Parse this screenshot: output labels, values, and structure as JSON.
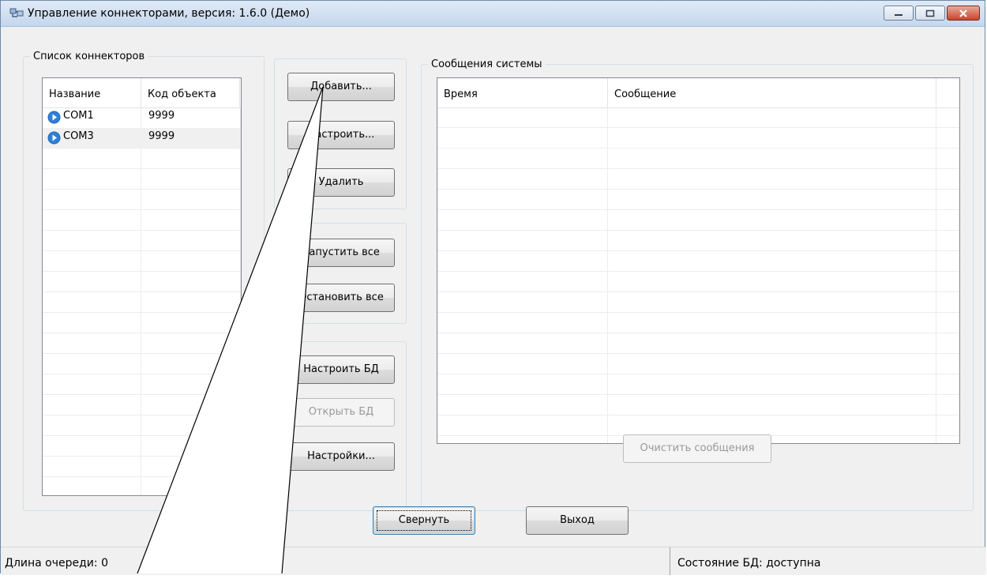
{
  "window": {
    "title": "Управление коннекторами, версия: 1.6.0 (Демо)"
  },
  "connectors": {
    "group_title": "Список коннекторов",
    "columns": [
      "Название",
      "Код объекта"
    ],
    "rows": [
      {
        "name": "COM1",
        "code": "9999"
      },
      {
        "name": "COM3",
        "code": "9999"
      }
    ]
  },
  "buttons": {
    "add": "Добавить...",
    "configure": "Настроить...",
    "delete": "Удалить",
    "start_all": "Запустить все",
    "stop_all": "Остановить все",
    "configure_db": "Настроить БД",
    "open_db": "Открыть БД",
    "settings": "Настройки...",
    "clear_messages": "Очистить сообщения",
    "minimize": "Свернуть",
    "exit": "Выход"
  },
  "messages": {
    "group_title": "Сообщения системы",
    "columns": [
      "Время",
      "Сообщение"
    ]
  },
  "status_bar": {
    "queue_length": "Длина очереди: 0",
    "db_state": "Состояние БД: доступна"
  },
  "colors": {
    "close_button": "#c9452c",
    "title_gradient": "#c5d7ec",
    "callout_line": "#000000"
  }
}
